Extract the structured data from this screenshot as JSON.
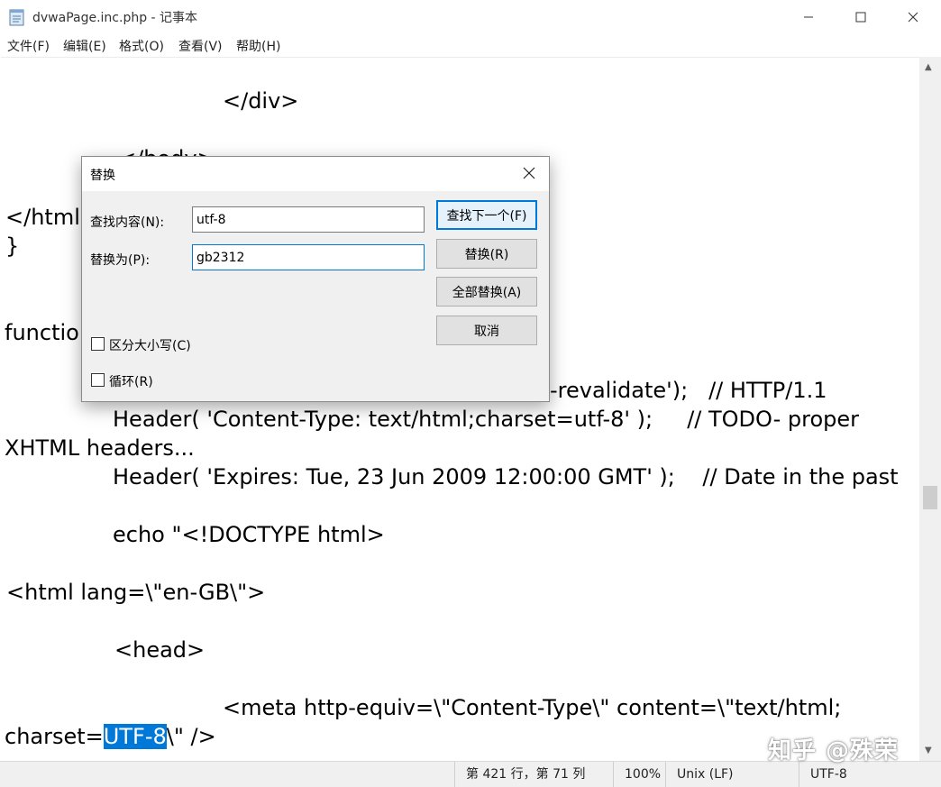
{
  "window": {
    "title": "dvwaPage.inc.php - 记事本",
    "app_icon": "notepad-icon",
    "controls": [
      "minimize-icon",
      "maximize-icon",
      "close-icon"
    ]
  },
  "menu": [
    "文件(F)",
    "编辑(E)",
    "格式(O)",
    "查看(V)",
    "帮助(H)"
  ],
  "editor": {
    "lines": [
      "</div>",
      "</body>",
      "</html",
      "}",
      "functio",
      "-revalidate');   // HTTP/1.1",
      "Header( 'Content-Type: text/html;charset=utf-8' );     // TODO- proper",
      "XHTML headers...",
      "Header( 'Expires: Tue, 23 Jun 2009 12:00:00 GMT' );    // Date in the past",
      "echo \"<!DOCTYPE html>",
      "<html lang=\\\"en-GB\\\">",
      "<head>",
      "<meta http-equiv=\\\"Content-Type\\\" content=\\\"text/html;"
    ],
    "last_line": {
      "prefix": "charset=",
      "selected": "UTF-8",
      "suffix": "\\\" />"
    },
    "selection_color": "#0078d7"
  },
  "dialog": {
    "title": "替换",
    "find_label": "查找内容(N):",
    "find_value": "utf-8",
    "replace_label": "替换为(P):",
    "replace_value": "gb2312",
    "buttons": {
      "find_next": "查找下一个(F)",
      "replace": "替换(R)",
      "replace_all": "全部替换(A)",
      "cancel": "取消"
    },
    "match_case": {
      "label": "区分大小写(C)",
      "checked": false
    },
    "wrap_around": {
      "label": "循环(R)",
      "checked": false
    }
  },
  "status": {
    "position": "第 421 行，第 71 列",
    "zoom": "100%",
    "line_ending": "Unix (LF)",
    "encoding": "UTF-8"
  },
  "watermark": "知乎 @殊荣"
}
